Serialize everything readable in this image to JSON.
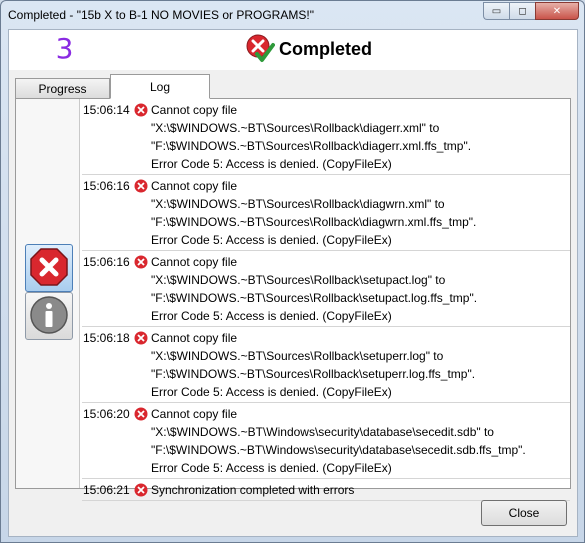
{
  "window": {
    "title": "Completed - \"15b  X to B-1 NO MOVIES or PROGRAMS!\""
  },
  "caption": {
    "min": "▭",
    "max": "◻",
    "close": "✕"
  },
  "header": {
    "count": "3",
    "status": "Completed",
    "status_icon": "error-check-icon"
  },
  "tabs": [
    {
      "label": "Progress"
    },
    {
      "label": "Log"
    }
  ],
  "filters": [
    {
      "name": "error-filter-icon"
    },
    {
      "name": "info-filter-icon"
    }
  ],
  "log": [
    {
      "time": "15:06:14",
      "lines": [
        "Cannot copy file",
        "\"X:\\$WINDOWS.~BT\\Sources\\Rollback\\diagerr.xml\" to",
        "\"F:\\$WINDOWS.~BT\\Sources\\Rollback\\diagerr.xml.ffs_tmp\".",
        "Error Code 5: Access is denied. (CopyFileEx)"
      ]
    },
    {
      "time": "15:06:16",
      "lines": [
        "Cannot copy file",
        "\"X:\\$WINDOWS.~BT\\Sources\\Rollback\\diagwrn.xml\" to",
        "\"F:\\$WINDOWS.~BT\\Sources\\Rollback\\diagwrn.xml.ffs_tmp\".",
        "Error Code 5: Access is denied. (CopyFileEx)"
      ]
    },
    {
      "time": "15:06:16",
      "lines": [
        "Cannot copy file",
        "\"X:\\$WINDOWS.~BT\\Sources\\Rollback\\setupact.log\" to",
        "\"F:\\$WINDOWS.~BT\\Sources\\Rollback\\setupact.log.ffs_tmp\".",
        "Error Code 5: Access is denied. (CopyFileEx)"
      ]
    },
    {
      "time": "15:06:18",
      "lines": [
        "Cannot copy file",
        "\"X:\\$WINDOWS.~BT\\Sources\\Rollback\\setuperr.log\" to",
        "\"F:\\$WINDOWS.~BT\\Sources\\Rollback\\setuperr.log.ffs_tmp\".",
        "Error Code 5: Access is denied. (CopyFileEx)"
      ]
    },
    {
      "time": "15:06:20",
      "lines": [
        "Cannot copy file",
        "\"X:\\$WINDOWS.~BT\\Windows\\security\\database\\secedit.sdb\" to",
        "\"F:\\$WINDOWS.~BT\\Windows\\security\\database\\secedit.sdb.ffs_tmp\".",
        "Error Code 5: Access is denied. (CopyFileEx)"
      ]
    },
    {
      "time": "15:06:21",
      "lines": [
        "Synchronization completed with errors"
      ]
    }
  ],
  "footer": {
    "close_label": "Close"
  },
  "colors": {
    "error": "#d9272e",
    "count": "#8a2be2",
    "check": "#2e9a3a"
  }
}
